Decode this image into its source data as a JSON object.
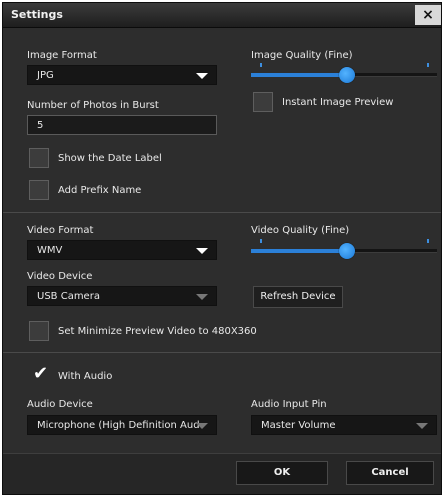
{
  "window": {
    "title": "Settings",
    "close_label": "×"
  },
  "image": {
    "format_label": "Image Format",
    "format_value": "JPG",
    "burst_label": "Number of Photos in Burst",
    "burst_value": "5",
    "show_date_label": "Show the Date Label",
    "show_date_checked": false,
    "add_prefix_label": "Add Prefix Name",
    "add_prefix_checked": false,
    "quality_label": "Image Quality  (Fine)",
    "quality_level": 0.52,
    "instant_preview_label": "Instant Image Preview",
    "instant_preview_checked": false
  },
  "video": {
    "format_label": "Video Format",
    "format_value": "WMV",
    "device_label": "Video Device",
    "device_value": "USB Camera",
    "quality_label": "Video Quality  (Fine)",
    "quality_level": 0.52,
    "refresh_button": "Refresh Device",
    "minimize_label": "Set Minimize Preview Video to 480X360",
    "minimize_checked": false
  },
  "audio": {
    "with_audio_label": "With Audio",
    "with_audio_checked": true,
    "device_label": "Audio Device",
    "device_value": "Microphone (High Definition Aud",
    "pin_label": "Audio Input Pin",
    "pin_value": "Master Volume"
  },
  "footer": {
    "ok_label": "OK",
    "cancel_label": "Cancel"
  }
}
